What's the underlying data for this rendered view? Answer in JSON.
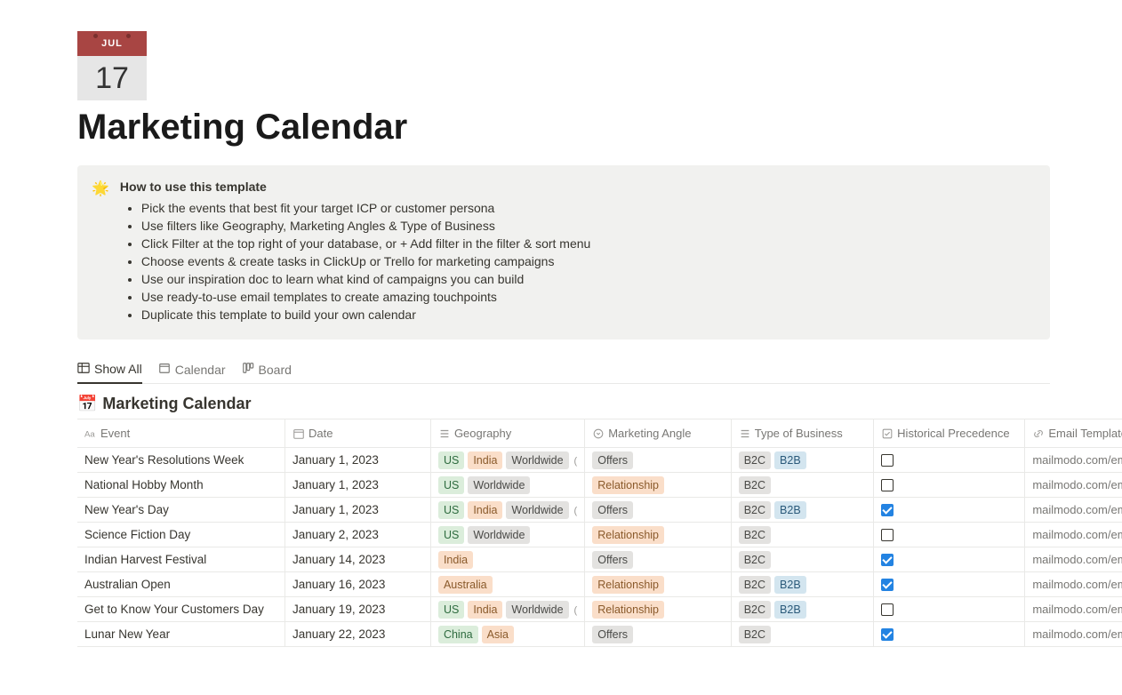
{
  "icon": {
    "month": "JUL",
    "day": "17"
  },
  "page_title": "Marketing Calendar",
  "callout": {
    "icon": "🌟",
    "title": "How to use this template",
    "items": [
      "Pick the events that best fit your target ICP or customer persona",
      "Use filters like Geography, Marketing Angles & Type of Business",
      "Click Filter at the top right of your database, or + Add filter in the filter & sort menu",
      "Choose events & create tasks in ClickUp or Trello for marketing campaigns",
      "Use our inspiration doc to learn what kind of campaigns you can build",
      "Use ready-to-use email templates to create amazing touchpoints",
      "Duplicate this template to build your own calendar"
    ]
  },
  "views": [
    {
      "label": "Show All",
      "icon": "table",
      "active": true
    },
    {
      "label": "Calendar",
      "icon": "calendar",
      "active": false
    },
    {
      "label": "Board",
      "icon": "board",
      "active": false
    }
  ],
  "db_title": {
    "icon": "📅",
    "text": "Marketing Calendar"
  },
  "columns": [
    {
      "key": "event",
      "label": "Event",
      "icon": "title"
    },
    {
      "key": "date",
      "label": "Date",
      "icon": "date"
    },
    {
      "key": "geo",
      "label": "Geography",
      "icon": "multi"
    },
    {
      "key": "angle",
      "label": "Marketing Angle",
      "icon": "select"
    },
    {
      "key": "biz",
      "label": "Type of Business",
      "icon": "multi"
    },
    {
      "key": "hist",
      "label": "Historical Precedence",
      "icon": "check"
    },
    {
      "key": "tmpl",
      "label": "Email Template",
      "icon": "link"
    }
  ],
  "rows": [
    {
      "event": "New Year's Resolutions Week",
      "date": "January 1, 2023",
      "geo": [
        "US",
        "India",
        "Worldwide"
      ],
      "geo_more": true,
      "angle": "Offers",
      "biz": [
        "B2C",
        "B2B"
      ],
      "hist": false,
      "tmpl": "mailmodo.com/em"
    },
    {
      "event": "National Hobby Month",
      "date": "January 1, 2023",
      "geo": [
        "US",
        "Worldwide"
      ],
      "geo_more": false,
      "angle": "Relationship",
      "biz": [
        "B2C"
      ],
      "hist": false,
      "tmpl": "mailmodo.com/em"
    },
    {
      "event": "New Year's Day",
      "date": "January 1, 2023",
      "geo": [
        "US",
        "India",
        "Worldwide"
      ],
      "geo_more": true,
      "angle": "Offers",
      "biz": [
        "B2C",
        "B2B"
      ],
      "hist": true,
      "tmpl": "mailmodo.com/em"
    },
    {
      "event": "Science Fiction Day",
      "date": "January 2, 2023",
      "geo": [
        "US",
        "Worldwide"
      ],
      "geo_more": false,
      "angle": "Relationship",
      "biz": [
        "B2C"
      ],
      "hist": false,
      "tmpl": "mailmodo.com/em"
    },
    {
      "event": "Indian Harvest Festival",
      "date": "January 14, 2023",
      "geo": [
        "India"
      ],
      "geo_more": false,
      "angle": "Offers",
      "biz": [
        "B2C"
      ],
      "hist": true,
      "tmpl": "mailmodo.com/em"
    },
    {
      "event": "Australian Open",
      "date": "January 16, 2023",
      "geo": [
        "Australia"
      ],
      "geo_more": false,
      "angle": "Relationship",
      "biz": [
        "B2C",
        "B2B"
      ],
      "hist": true,
      "tmpl": "mailmodo.com/em"
    },
    {
      "event": "Get to Know Your Customers Day",
      "date": "January 19, 2023",
      "geo": [
        "US",
        "India",
        "Worldwide"
      ],
      "geo_more": true,
      "angle": "Relationship",
      "biz": [
        "B2C",
        "B2B"
      ],
      "hist": false,
      "tmpl": "mailmodo.com/em"
    },
    {
      "event": "Lunar New Year",
      "date": "January 22, 2023",
      "geo": [
        "China",
        "Asia"
      ],
      "geo_more": false,
      "angle": "Offers",
      "biz": [
        "B2C"
      ],
      "hist": true,
      "tmpl": "mailmodo.com/em"
    }
  ],
  "tag_classes": {
    "US": "tag-us",
    "India": "tag-india",
    "Worldwide": "tag-worldwide",
    "Australia": "tag-australia",
    "China": "tag-china",
    "Asia": "tag-asia",
    "Offers": "tag-offers",
    "Relationship": "tag-relationship",
    "B2C": "tag-b2c",
    "B2B": "tag-b2b"
  }
}
